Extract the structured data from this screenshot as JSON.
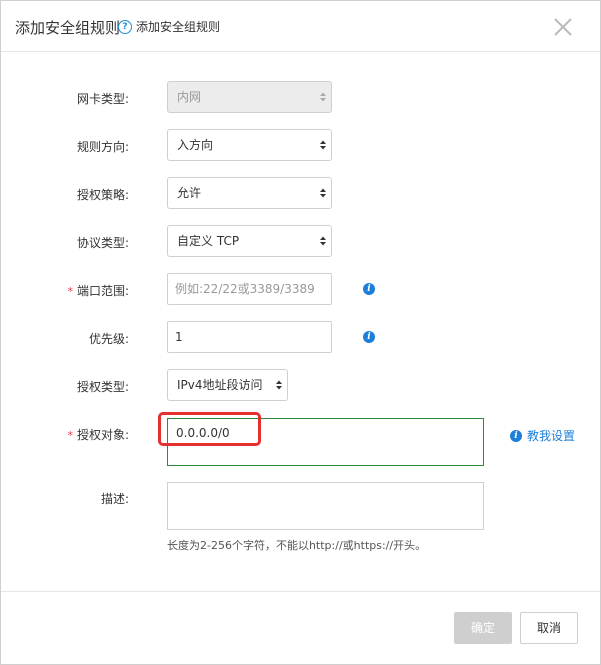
{
  "dialog": {
    "title": "添加安全组规则",
    "help_text": "添加安全组规则",
    "help_icon": "?"
  },
  "form": {
    "nic_type": {
      "label": "网卡类型:",
      "value": "内网"
    },
    "direction": {
      "label": "规则方向:",
      "value": "入方向"
    },
    "policy": {
      "label": "授权策略:",
      "value": "允许"
    },
    "protocol": {
      "label": "协议类型:",
      "value": "自定义 TCP"
    },
    "port_range": {
      "label": "端口范围:",
      "required_mark": "*",
      "placeholder": "例如:22/22或3389/3389"
    },
    "priority": {
      "label": "优先级:",
      "value": "1"
    },
    "auth_type": {
      "label": "授权类型:",
      "value": "IPv4地址段访问"
    },
    "auth_object": {
      "label": "授权对象:",
      "required_mark": "*",
      "value": "0.0.0.0/0",
      "guide_link": "教我设置"
    },
    "description": {
      "label": "描述:",
      "value": "",
      "hint": "长度为2-256个字符，不能以http://或https://开头。"
    }
  },
  "footer": {
    "ok_label": "确定",
    "cancel_label": "取消"
  },
  "icons": {
    "info": "i"
  },
  "colors": {
    "accent": "#1e7fd8",
    "valid_border": "#2e8b3a",
    "highlight": "#e53030"
  }
}
